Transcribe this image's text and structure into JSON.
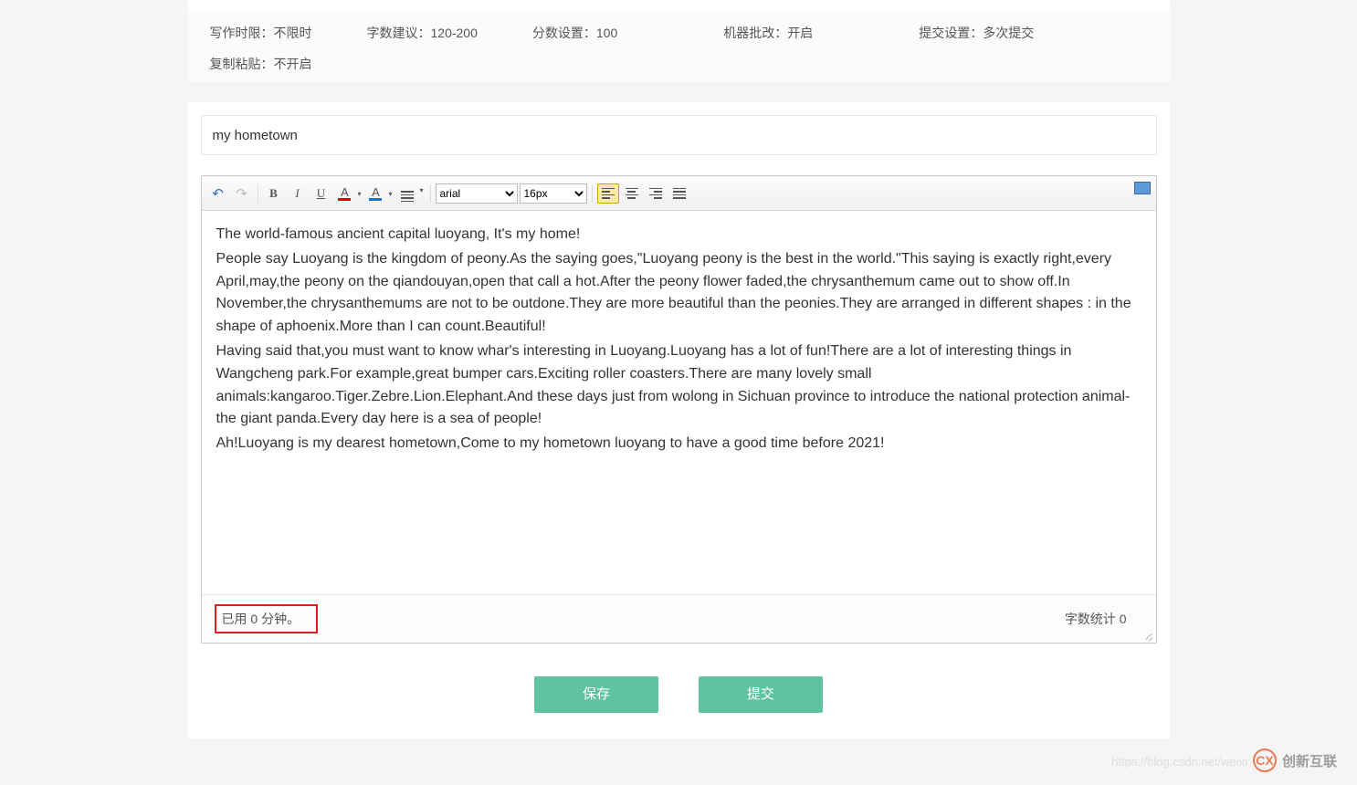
{
  "settings": {
    "timeLimit": {
      "label": "写作时限：",
      "value": "不限时"
    },
    "wordSuggest": {
      "label": "字数建议：",
      "value": "120-200"
    },
    "scoreSet": {
      "label": "分数设置：",
      "value": "100"
    },
    "machineGrade": {
      "label": "机器批改：",
      "value": "开启"
    },
    "submitSet": {
      "label": "提交设置：",
      "value": "多次提交"
    },
    "copyPaste": {
      "label": "复制粘贴：",
      "value": "不开启"
    }
  },
  "titleField": {
    "value": "my hometown"
  },
  "toolbar": {
    "fontFamily": "arial",
    "fontSize": "16px"
  },
  "editorContent": {
    "p1": "The world-famous ancient capital luoyang, It's my home!",
    "p2": "People say Luoyang is the kingdom of peony.As the saying goes,\"Luoyang peony is the best in the world.\"This saying is exactly right,every April,may,the peony on the qiandouyan,open that call a hot.After the peony flower faded,the chrysanthemum came out to show off.In November,the chrysanthemums are not to be outdone.They are more beautiful than the peonies.They are arranged in different shapes : in the shape of aphoenix.More than I can count.Beautiful!",
    "p3": "Having said that,you must want to know whar's interesting in Luoyang.Luoyang has a lot of fun!There are a lot of interesting things in Wangcheng park.For example,great bumper cars.Exciting roller coasters.There are many lovely small animals:kangaroo.Tiger.Zebre.Lion.Elephant.And these days just from wolong in Sichuan province to introduce the national protection animal- the giant panda.Every day here is a sea of people!",
    "p4": "Ah!Luoyang is my dearest hometown,Come to my hometown  luoyang to have a good time before 2021!"
  },
  "status": {
    "timer": "已用 0 分钟。",
    "wordCountLabel": "字数统计 ",
    "wordCountValue": "0"
  },
  "actions": {
    "save": "保存",
    "submit": "提交"
  },
  "watermark": {
    "logo": "CX",
    "text": "创新互联",
    "url": "https://blog.csdn.net/weixi"
  }
}
